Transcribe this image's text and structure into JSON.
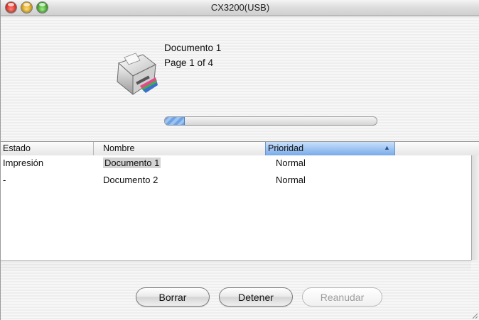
{
  "window": {
    "title": "CX3200(USB)"
  },
  "current_job": {
    "document": "Documento 1",
    "page_info": "Page 1 of 4",
    "progress_fraction": 0.09
  },
  "table": {
    "columns": [
      "Estado",
      "Nombre",
      "Prioridad"
    ],
    "sorted_column": "Prioridad",
    "rows": [
      {
        "estado": "Impresión",
        "nombre": "Documento 1",
        "prioridad": "Normal"
      },
      {
        "estado": "-",
        "nombre": "Documento 2",
        "prioridad": "Normal"
      }
    ]
  },
  "buttons": {
    "delete": "Borrar",
    "stop": "Detener",
    "resume": "Reanudar"
  },
  "icons": {
    "printer": "printer-icon",
    "sort": "sort-ascending-icon"
  }
}
